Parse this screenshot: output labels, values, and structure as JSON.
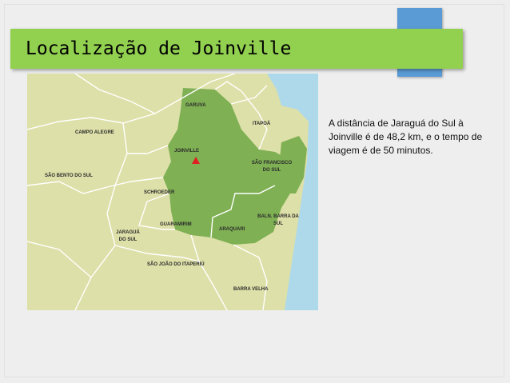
{
  "slide": {
    "title": "Localização de Joinville",
    "body_text": "A distância de Jaraguá do Sul à Joinville é de 48,2 km, e o tempo de viagem é de 50 minutos.",
    "colors": {
      "title_bar": "#92d050",
      "accent_tab": "#5b9bd5",
      "background": "#eeeeee"
    }
  },
  "map": {
    "labels": {
      "garuva": "GARUVA",
      "itapoa": "ITAPOÁ",
      "campo_alegre": "CAMPO ALEGRE",
      "joinville": "JOINVILLE",
      "sao_francisco": "SÃO FRANCISCO DO SUL",
      "sao_bento": "SÃO BENTO DO SUL",
      "schroeder": "SCHROEDER",
      "balneario_barra": "BALN. BARRA DA SUL",
      "guaramirim": "GUARAMIRIM",
      "araquari": "ARAQUARI",
      "jaragua": "JARAGUÁ DO SUL",
      "sao_joao": "SÃO JOÃO DO ITAPERIÚ",
      "barra_velha": "BARRA VELHA"
    },
    "marker_icon": "red-triangle-marker-icon",
    "colors": {
      "land": "#dde0a8",
      "region": "#7fb054",
      "sea": "#aed9ea",
      "border": "#ffffff",
      "marker": "#e02020"
    }
  }
}
